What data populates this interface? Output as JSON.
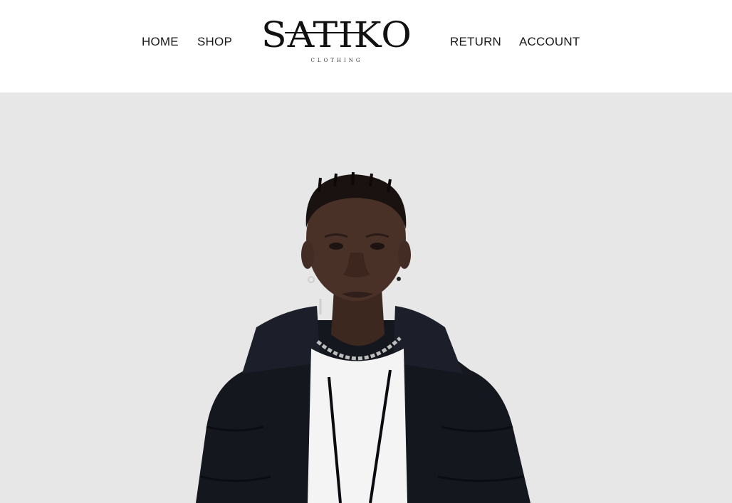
{
  "nav": {
    "home": "HOME",
    "shop": "SHOP",
    "return": "RETURN",
    "account": "ACCOUNT"
  },
  "logo": {
    "wordmark": "SATIKO",
    "tagline": "CLOTHING"
  },
  "hero": {
    "image": "model-in-black-puffer-jacket",
    "background": "#e7e7e7"
  },
  "colors": {
    "text": "#1a1a1a",
    "jacket": "#15171f",
    "skin": "#4a3128"
  }
}
